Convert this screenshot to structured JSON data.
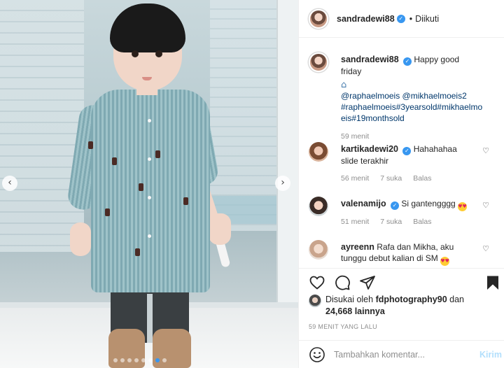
{
  "header": {
    "username": "sandradewi88",
    "separator": "•",
    "follow_label": "Diikuti"
  },
  "caption": {
    "username": "sandradewi88",
    "text": "Happy good friday",
    "emoji": "house-with-garden-emoji",
    "mentions_line1": "@raphaelmoeis @mikhaelmoeis2",
    "hashtags_line2": "#raphaelmoeis#3yearsold#mikhaelmo",
    "hashtags_line3": "eis#19monthsold",
    "time": "59 menit"
  },
  "comments": [
    {
      "username": "kartikadewi20",
      "verified": true,
      "text_line1": "Hahahahaa",
      "text_line2": "slide terakhir",
      "time": "56 menit",
      "likes": "7 suka",
      "reply": "Balas"
    },
    {
      "username": "valenamijo",
      "verified": true,
      "text_line1": "Si gantengggg",
      "emoji": "heart-eyes-emoji",
      "time": "51 menit",
      "likes": "7 suka",
      "reply": "Balas"
    },
    {
      "username": "ayreenn",
      "verified": false,
      "text_line1": "Rafa dan Mikha, aku",
      "text_line2": "tunggu debut kalian di SM",
      "emoji": "heart-eyes-emoji"
    }
  ],
  "likes": {
    "prefix": "Disukai oleh",
    "user": "fdphotography90",
    "joiner": "dan",
    "count": "24,668 lainnya"
  },
  "timestamp": "59 MENIT YANG LALU",
  "add_comment": {
    "placeholder": "Tambahkan komentar...",
    "post_label": "Kirim"
  },
  "carousel": {
    "prev_glyph": "‹",
    "next_glyph": "›",
    "slide_count": 8,
    "active_index": 6
  },
  "icons": {
    "verified": "verified-badge-icon",
    "heart": "heart-icon",
    "comment": "comment-icon",
    "share": "share-icon",
    "save": "save-bookmark-icon",
    "emoji": "emoji-smile-icon"
  },
  "colors": {
    "verified": "#3897f0",
    "link": "#00376b",
    "muted": "#8e8e8e",
    "post_button": "#b2dffc"
  }
}
